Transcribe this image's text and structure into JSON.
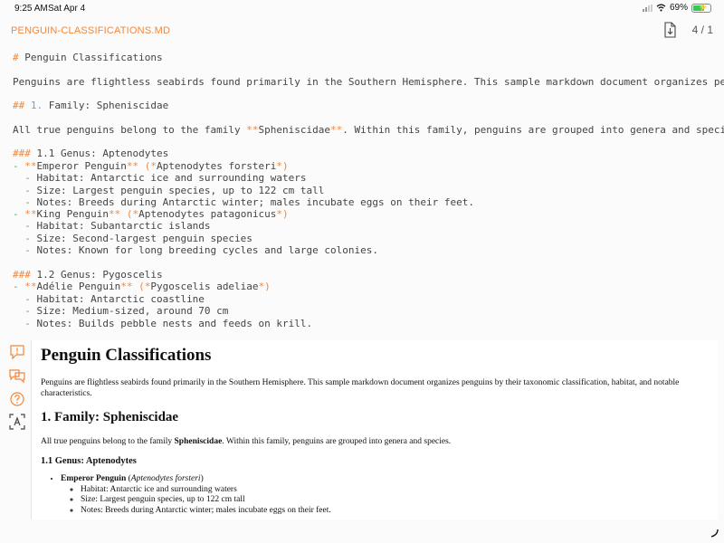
{
  "status_bar": {
    "time": "9:25 AM",
    "date": "Sat Apr 4",
    "battery": "69%",
    "battery_level": 0.69
  },
  "header": {
    "filename": "PENGUIN-CLASSIFICATIONS.MD",
    "page_count": "4 / 1"
  },
  "source_lines": [
    {
      "parts": [
        {
          "t": "# ",
          "c": "mk"
        },
        {
          "t": "Penguin Classifications"
        }
      ]
    },
    {
      "parts": []
    },
    {
      "parts": [
        {
          "t": "Penguins are flightless seabirds found primarily in the Southern Hemisphere. This sample markdown document organizes pengu"
        }
      ]
    },
    {
      "parts": []
    },
    {
      "parts": [
        {
          "t": "## ",
          "c": "mk"
        },
        {
          "t": "1.",
          "c": "mk-num"
        },
        {
          "t": " Family: Spheniscidae"
        }
      ]
    },
    {
      "parts": []
    },
    {
      "parts": [
        {
          "t": "All true penguins belong to the family "
        },
        {
          "t": "**",
          "c": "mk"
        },
        {
          "t": "Spheniscidae"
        },
        {
          "t": "**",
          "c": "mk"
        },
        {
          "t": ". Within this family, penguins are grouped into genera and species."
        }
      ]
    },
    {
      "parts": []
    },
    {
      "parts": [
        {
          "t": "### ",
          "c": "mk"
        },
        {
          "t": "1.1 Genus: Aptenodytes"
        }
      ]
    },
    {
      "parts": [
        {
          "t": "- ",
          "c": "mk-dash"
        },
        {
          "t": "**",
          "c": "mk"
        },
        {
          "t": "Emperor Penguin"
        },
        {
          "t": "** (*",
          "c": "mk"
        },
        {
          "t": "Aptenodytes forsteri"
        },
        {
          "t": "*)",
          "c": "mk"
        }
      ]
    },
    {
      "parts": [
        {
          "t": "  - ",
          "c": "mk-dash"
        },
        {
          "t": "Habitat: Antarctic ice and surrounding waters"
        }
      ]
    },
    {
      "parts": [
        {
          "t": "  - ",
          "c": "mk-dash"
        },
        {
          "t": "Size: Largest penguin species, up to 122 cm tall"
        }
      ]
    },
    {
      "parts": [
        {
          "t": "  - ",
          "c": "mk-dash"
        },
        {
          "t": "Notes: Breeds during Antarctic winter; males incubate eggs on their feet."
        }
      ]
    },
    {
      "parts": [
        {
          "t": "- ",
          "c": "mk-dash"
        },
        {
          "t": "**",
          "c": "mk"
        },
        {
          "t": "King Penguin"
        },
        {
          "t": "** (*",
          "c": "mk"
        },
        {
          "t": "Aptenodytes patagonicus"
        },
        {
          "t": "*)",
          "c": "mk"
        }
      ]
    },
    {
      "parts": [
        {
          "t": "  - ",
          "c": "mk-dash"
        },
        {
          "t": "Habitat: Subantarctic islands"
        }
      ]
    },
    {
      "parts": [
        {
          "t": "  - ",
          "c": "mk-dash"
        },
        {
          "t": "Size: Second-largest penguin species"
        }
      ]
    },
    {
      "parts": [
        {
          "t": "  - ",
          "c": "mk-dash"
        },
        {
          "t": "Notes: Known for long breeding cycles and large colonies."
        }
      ]
    },
    {
      "parts": []
    },
    {
      "parts": [
        {
          "t": "### ",
          "c": "mk"
        },
        {
          "t": "1.2 Genus: Pygoscelis"
        }
      ]
    },
    {
      "parts": [
        {
          "t": "- ",
          "c": "mk-dash"
        },
        {
          "t": "**",
          "c": "mk"
        },
        {
          "t": "Adélie Penguin"
        },
        {
          "t": "** (*",
          "c": "mk"
        },
        {
          "t": "Pygoscelis adeliae"
        },
        {
          "t": "*)",
          "c": "mk"
        }
      ]
    },
    {
      "parts": [
        {
          "t": "  - ",
          "c": "mk-dash"
        },
        {
          "t": "Habitat: Antarctic coastline"
        }
      ]
    },
    {
      "parts": [
        {
          "t": "  - ",
          "c": "mk-dash"
        },
        {
          "t": "Size: Medium-sized, around 70 cm"
        }
      ]
    },
    {
      "parts": [
        {
          "t": "  - ",
          "c": "mk-dash"
        },
        {
          "t": "Notes: Builds pebble nests and feeds on krill."
        }
      ]
    }
  ],
  "preview": {
    "title": "Penguin Classifications",
    "intro": "Penguins are flightless seabirds found primarily in the Southern Hemisphere. This sample markdown document organizes penguins by their taxonomic classification, habitat, and notable characteristics.",
    "family_heading": "1. Family: Spheniscidae",
    "family_text_before": "All true penguins belong to the family ",
    "family_text_bold": "Spheniscidae",
    "family_text_after": ". Within this family, penguins are grouped into genera and species.",
    "genus_heading": "1.1 Genus: Aptenodytes",
    "species_name": "Emperor Penguin",
    "species_latin": "Aptenodytes forsteri",
    "species_paren_open": " (",
    "species_paren_close": ")",
    "bullets": [
      "Habitat: Antarctic ice and surrounding waters",
      "Size: Largest penguin species, up to 122 cm tall",
      "Notes: Breeds during Antarctic winter; males incubate eggs on their feet."
    ]
  },
  "toolbar": {
    "icons": [
      "comment-alert-icon",
      "comments-icon",
      "help-icon",
      "text-scan-icon"
    ]
  },
  "colors": {
    "accent": "#f0883e",
    "heading_number": "#6aa0d8",
    "list_dash": "#5aa06a",
    "battery_fill": "#34c759"
  }
}
